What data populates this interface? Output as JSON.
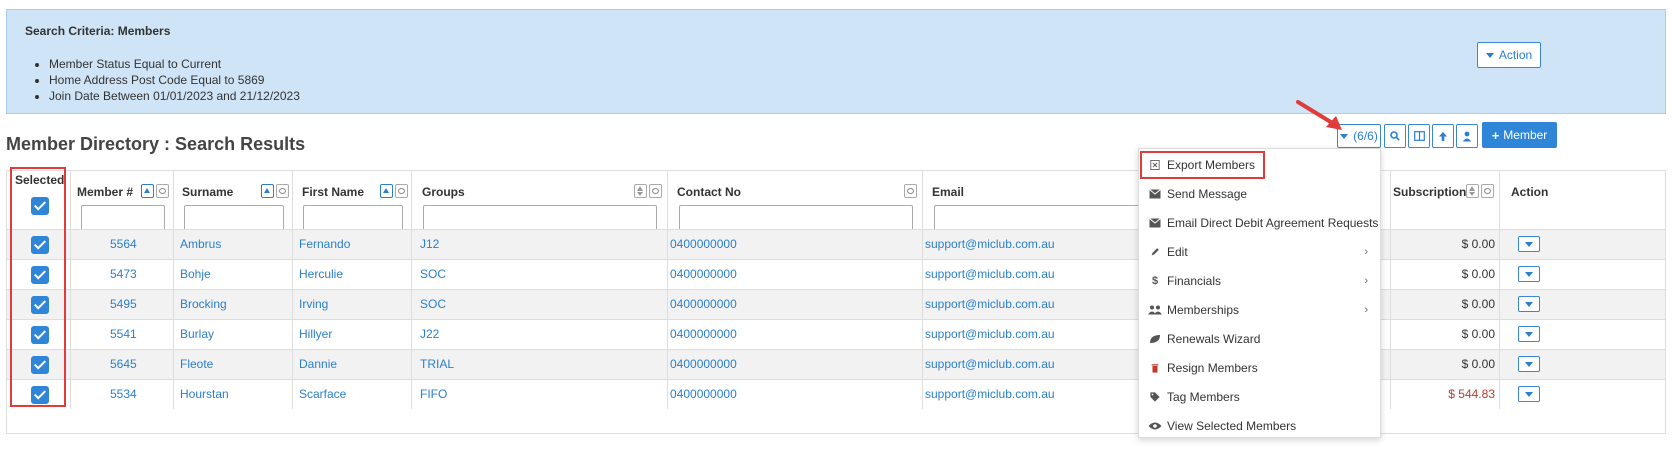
{
  "search_criteria": {
    "title": "Search Criteria: Members",
    "items": [
      "Member Status Equal to Current",
      "Home Address Post Code Equal to 5869",
      "Join Date Between 01/01/2023 and 21/12/2023"
    ],
    "action_label": "Action"
  },
  "page_title": "Member Directory : Search Results",
  "toolbar": {
    "columns_label": "(6/6)",
    "add_member_label": "Member"
  },
  "table": {
    "columns": [
      "Selected",
      "Member #",
      "Surname",
      "First Name",
      "Groups",
      "Contact No",
      "Email",
      "Subscription",
      "Action"
    ],
    "rows": [
      {
        "member": "5564",
        "surname": "Ambrus",
        "first": "Fernando",
        "group": "J12",
        "contact": "0400000000",
        "email": "support@miclub.com.au",
        "subscription": "$ 0.00"
      },
      {
        "member": "5473",
        "surname": "Bohje",
        "first": "Herculie",
        "group": "SOC",
        "contact": "0400000000",
        "email": "support@miclub.com.au",
        "subscription": "$ 0.00"
      },
      {
        "member": "5495",
        "surname": "Brocking",
        "first": "Irving",
        "group": "SOC",
        "contact": "0400000000",
        "email": "support@miclub.com.au",
        "subscription": "$ 0.00"
      },
      {
        "member": "5541",
        "surname": "Burlay",
        "first": "Hillyer",
        "group": "J22",
        "contact": "0400000000",
        "email": "support@miclub.com.au",
        "subscription": "$ 0.00"
      },
      {
        "member": "5645",
        "surname": "Fleote",
        "first": "Dannie",
        "group": "TRIAL",
        "contact": "0400000000",
        "email": "support@miclub.com.au",
        "subscription": "$ 0.00"
      },
      {
        "member": "5534",
        "surname": "Hourstan",
        "first": "Scarface",
        "group": "FIFO",
        "contact": "0400000000",
        "email": "support@miclub.com.au",
        "subscription": "$ 544.83"
      }
    ]
  },
  "menu": {
    "items": [
      {
        "label": "Export Members",
        "icon": "excel-icon",
        "submenu": false
      },
      {
        "label": "Send Message",
        "icon": "envelope-icon",
        "submenu": false
      },
      {
        "label": "Email Direct Debit Agreement Requests",
        "icon": "envelope-icon",
        "submenu": false
      },
      {
        "label": "Edit",
        "icon": "pencil-icon",
        "submenu": true
      },
      {
        "label": "Financials",
        "icon": "dollar-icon",
        "submenu": true
      },
      {
        "label": "Memberships",
        "icon": "users-icon",
        "submenu": true
      },
      {
        "label": "Renewals Wizard",
        "icon": "leaf-icon",
        "submenu": false
      },
      {
        "label": "Resign Members",
        "icon": "trash-icon",
        "submenu": false
      },
      {
        "label": "Tag Members",
        "icon": "tag-icon",
        "submenu": false
      },
      {
        "label": "View Selected Members",
        "icon": "eye-icon",
        "submenu": false
      }
    ]
  },
  "colors": {
    "accent": "#2f86d9",
    "criteria_bg": "#cfe4f6",
    "highlight": "#e03c3c",
    "negative_amount": "#c0392b"
  }
}
